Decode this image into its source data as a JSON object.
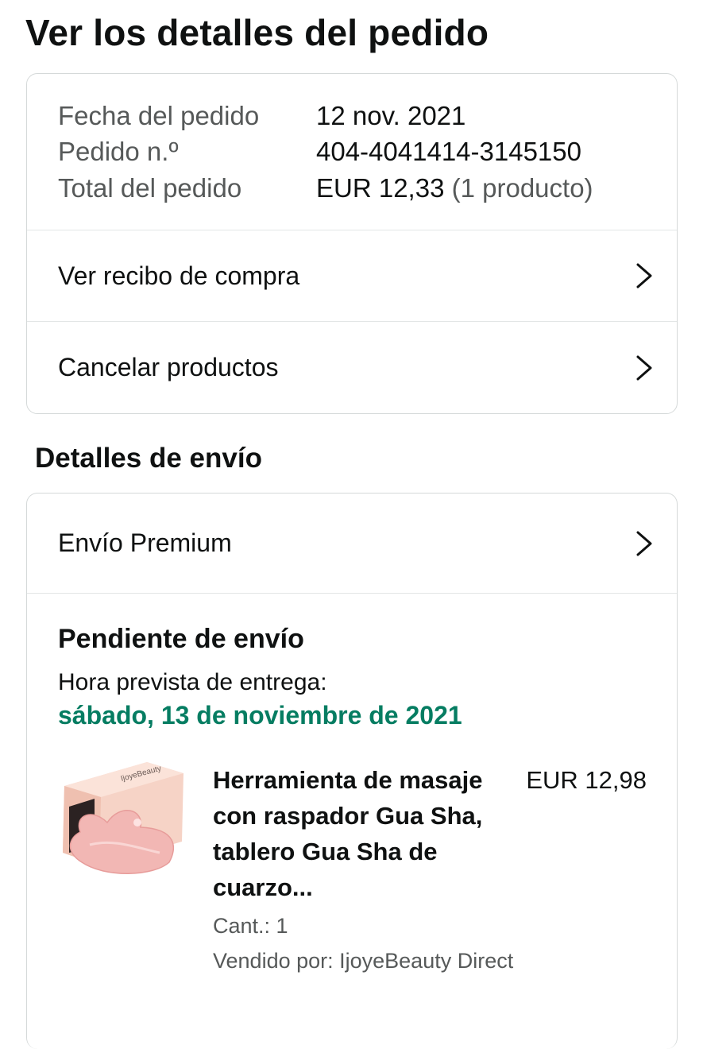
{
  "page": {
    "title": "Ver los detalles del pedido"
  },
  "summary": {
    "rows": [
      {
        "label": "Fecha del pedido",
        "value": "12 nov. 2021",
        "extra": ""
      },
      {
        "label": "Pedido n.º",
        "value": "404-4041414-3145150",
        "extra": ""
      },
      {
        "label": "Total del pedido",
        "value": "EUR 12,33",
        "extra": "(1 producto)"
      }
    ],
    "links": [
      {
        "label": "Ver recibo de compra",
        "icon": "chevron-right-icon"
      },
      {
        "label": "Cancelar productos",
        "icon": "chevron-right-icon"
      }
    ]
  },
  "shipping": {
    "section_title": "Detalles de envío",
    "method_label": "Envío Premium",
    "status": "Pendiente de envío",
    "delivery_label": "Hora prevista de entrega:",
    "delivery_date": "sábado, 13 de noviembre de 2021",
    "delivery_date_color": "#067d62",
    "product": {
      "title": "Herramienta de masaje con raspador Gua Sha, tablero Gua Sha de cuarzo...",
      "price": "EUR 12,98",
      "quantity": "Cant.: 1",
      "seller": "Vendido por: IjoyeBeauty Direct",
      "image_box_text": "IjoyeBeauty",
      "image_icon": "product-thumbnail"
    }
  }
}
